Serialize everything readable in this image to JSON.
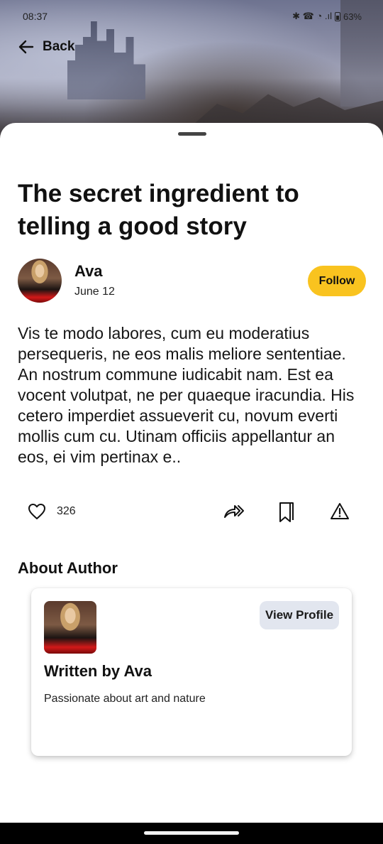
{
  "status_bar": {
    "time": "08:37",
    "icons": "✱ ☎ ◔ .ıl",
    "battery": "63%"
  },
  "header": {
    "back_label": "Back"
  },
  "article": {
    "title": "The secret ingredient to telling a good story",
    "author_name": "Ava",
    "date": "June 12",
    "follow_label": "Follow",
    "body": "Vis te modo labores, cum eu moderatius persequeris, ne eos malis meliore sententiae. An nostrum commune iudicabit nam. Est ea vocent volutpat, ne per quaeque iracundia. His cetero imperdiet assueverit cu, novum everti mollis cum cu. Utinam officiis appellantur an eos, ei vim pertinax e..",
    "likes": "326"
  },
  "about": {
    "heading": "About Author",
    "view_profile_label": "View Profile",
    "written_by": "Written by Ava",
    "bio": "Passionate about art and nature"
  },
  "colors": {
    "follow_button": "#f9c31f",
    "view_profile_button": "#e2e6ef"
  },
  "icons": [
    "back-arrow-icon",
    "heart-icon",
    "share-icon",
    "bookmark-icon",
    "report-icon"
  ]
}
